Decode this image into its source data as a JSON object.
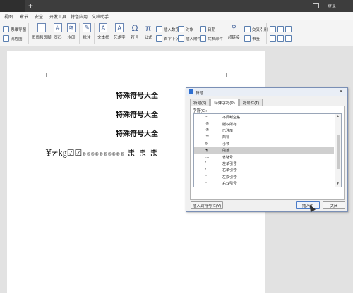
{
  "titlebar": {
    "new_tab": "+",
    "login": "登录"
  },
  "menu": [
    "视图",
    "章节",
    "安全",
    "开发工具",
    "特色应用",
    "文档助手"
  ],
  "ribbon": {
    "mind_map": "思维导图",
    "flowchart": "流程图",
    "header_footer": "页眉和页脚",
    "page_number": "页码",
    "watermark": "水印",
    "comment": "批注",
    "textbox": "文本框",
    "wordart": "艺术字",
    "symbol": "符号",
    "formula": "公式",
    "insert_number": "插入数字",
    "first_drop": "首字下沉",
    "object": "对象",
    "insert_attachment": "插入附件",
    "date": "日期",
    "doc_parts": "文档部件",
    "hyperlink": "超链接",
    "cross_ref": "交叉引用",
    "bookmark": "书签"
  },
  "document": {
    "lines": [
      "特殊符号大全",
      "特殊符号大全",
      "特殊符号大全"
    ],
    "symbol_line": "¥≠㎏☑☑",
    "symbol_line_small": "®®®®®®®®®®",
    "symbol_line_tail": "ま ま ま"
  },
  "dialog": {
    "title": "符号",
    "tabs": [
      "符号(S)",
      "特殊字符(P)",
      "符号栏(T)"
    ],
    "active_tab": 1,
    "char_label": "字符(C):",
    "rows": [
      {
        "glyph": "°",
        "name": "不间断空格"
      },
      {
        "glyph": "©",
        "name": "版权所有"
      },
      {
        "glyph": "®",
        "name": "已注册"
      },
      {
        "glyph": "™",
        "name": "商标"
      },
      {
        "glyph": "§",
        "name": "小节"
      },
      {
        "glyph": "¶",
        "name": "段落"
      },
      {
        "glyph": "…",
        "name": "省略号"
      },
      {
        "glyph": "'",
        "name": "左单引号"
      },
      {
        "glyph": "'",
        "name": "右单引号"
      },
      {
        "glyph": "\"",
        "name": "左双引号"
      },
      {
        "glyph": "\"",
        "name": "右双引号"
      }
    ],
    "selected_row": 5,
    "insert_to_bar": "插入到符号栏(Y)",
    "insert": "插入(I)",
    "close": "关闭"
  }
}
